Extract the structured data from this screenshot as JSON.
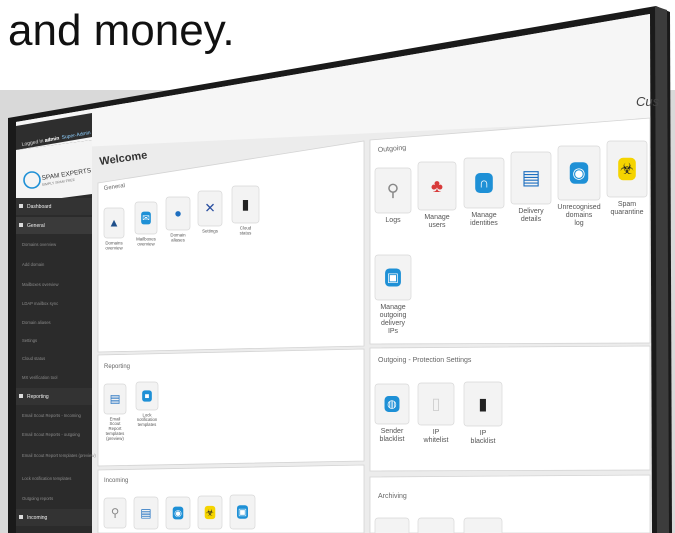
{
  "headline": {
    "line1": "",
    "line2": "and money."
  },
  "corner_text": "Cus",
  "topbar": {
    "logged_in_prefix": "Logged in as:",
    "user": "admin",
    "role": "Super-Admin"
  },
  "brand": {
    "name": "SPAM EXPERTS",
    "tagline": "SIMPLY SPAM FREE"
  },
  "sidebar": {
    "items": [
      {
        "label": "Dashboard",
        "type": "section",
        "icon": "home-icon"
      },
      {
        "label": "General",
        "type": "section-active",
        "icon": "gear-icon"
      },
      {
        "label": "Domains overview",
        "type": "item"
      },
      {
        "label": "Add domain",
        "type": "item"
      },
      {
        "label": "Mailboxes overview",
        "type": "item"
      },
      {
        "label": "LDAP mailbox sync",
        "type": "item"
      },
      {
        "label": "Domain aliases",
        "type": "item"
      },
      {
        "label": "Settings",
        "type": "item"
      },
      {
        "label": "Cloud status",
        "type": "item"
      },
      {
        "label": "MX verification tool",
        "type": "item"
      },
      {
        "label": "Reporting",
        "type": "section",
        "icon": "report-icon"
      },
      {
        "label": "Email Scout Reports - Incoming",
        "type": "item"
      },
      {
        "label": "Email Scout Reports - outgoing",
        "type": "item"
      },
      {
        "label": "Email Scout Report templates (preview)",
        "type": "item"
      },
      {
        "label": "Lock notification templates",
        "type": "item"
      },
      {
        "label": "Outgoing reports",
        "type": "item"
      },
      {
        "label": "Incoming",
        "type": "section",
        "icon": "inbox-icon"
      }
    ]
  },
  "main": {
    "welcome": "Welcome",
    "general": {
      "title": "General",
      "tiles": [
        {
          "label": "Domains overview",
          "icon": "domains-icon"
        },
        {
          "label": "Mailboxes overview",
          "icon": "mailbox-icon"
        },
        {
          "label": "Domain aliases",
          "icon": "globe-icon"
        },
        {
          "label": "Settings",
          "icon": "tools-icon"
        },
        {
          "label": "Cloud status",
          "icon": "server-icon"
        }
      ]
    },
    "reporting": {
      "title": "Reporting",
      "tiles": [
        {
          "label": "Email Scout Report templates (preview)",
          "icon": "report-doc-icon"
        },
        {
          "label": "Lock notification templates",
          "icon": "lock-icon"
        }
      ]
    },
    "incoming": {
      "title": "Incoming"
    },
    "outgoing": {
      "title": "Outgoing",
      "tiles": [
        {
          "label": "Logs",
          "icon": "search-icon"
        },
        {
          "label": "Manage users",
          "icon": "users-icon"
        },
        {
          "label": "Manage identities",
          "icon": "identity-icon"
        },
        {
          "label": "Delivery details",
          "icon": "document-icon"
        },
        {
          "label": "Unrecognised domains log",
          "icon": "clock-icon"
        },
        {
          "label": "Spam quarantine",
          "icon": "biohazard-icon"
        },
        {
          "label": "Manage outgoing delivery IPs",
          "icon": "network-icon"
        }
      ]
    },
    "protection": {
      "title": "Outgoing - Protection Settings",
      "tiles": [
        {
          "label": "Sender blacklist",
          "icon": "shield-icon"
        },
        {
          "label": "IP whitelist",
          "icon": "whitelist-icon"
        },
        {
          "label": "IP blacklist",
          "icon": "blacklist-icon"
        }
      ]
    },
    "archiving": {
      "title": "Archiving"
    }
  },
  "colors": {
    "accent": "#1e90d6",
    "sidebar": "#2b2b2b",
    "sidebar_active": "#3a3a3a",
    "bezel": "#1a1a1a"
  }
}
